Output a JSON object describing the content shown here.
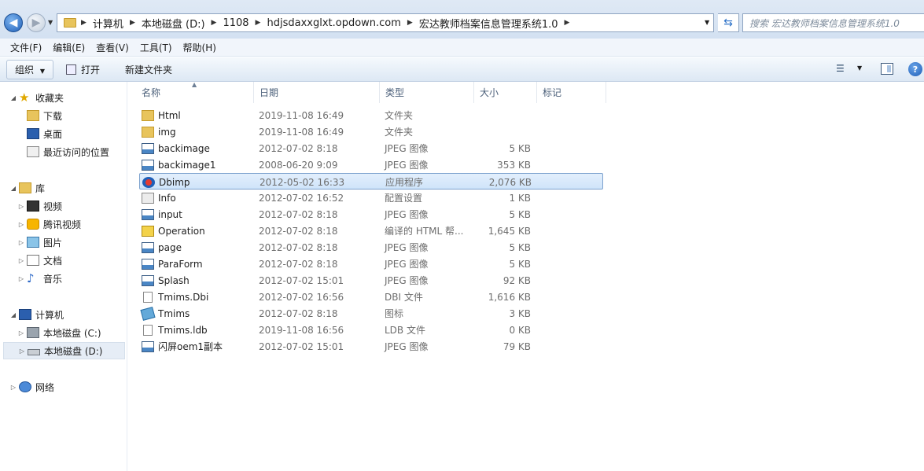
{
  "address": {
    "crumbs": [
      "计算机",
      "本地磁盘 (D:)",
      "1108",
      "hdjsdaxxglxt.opdown.com",
      "宏达教师档案信息管理系统1.0"
    ],
    "search_placeholder": "搜索 宏达教师档案信息管理系统1.0"
  },
  "menu": [
    "文件(F)",
    "编辑(E)",
    "查看(V)",
    "工具(T)",
    "帮助(H)"
  ],
  "toolbar": {
    "organize": "组织",
    "open": "打开",
    "new_folder": "新建文件夹"
  },
  "nav": {
    "favorites": "收藏夹",
    "downloads": "下载",
    "desktop": "桌面",
    "recent": "最近访问的位置",
    "libraries": "库",
    "videos": "视频",
    "tencent_video": "腾讯视频",
    "pictures": "图片",
    "documents": "文档",
    "music": "音乐",
    "computer": "计算机",
    "drive_c": "本地磁盘 (C:)",
    "drive_d": "本地磁盘 (D:)",
    "network": "网络"
  },
  "columns": [
    "名称",
    "日期",
    "类型",
    "大小",
    "标记"
  ],
  "files": [
    {
      "name": "Html",
      "date": "2019-11-08 16:49",
      "type": "文件夹",
      "size": "",
      "icon": "folder-icon"
    },
    {
      "name": "img",
      "date": "2019-11-08 16:49",
      "type": "文件夹",
      "size": "",
      "icon": "folder-icon"
    },
    {
      "name": "backimage",
      "date": "2012-07-02 8:18",
      "type": "JPEG 图像",
      "size": "5 KB",
      "icon": "jpeg-icon"
    },
    {
      "name": "backimage1",
      "date": "2008-06-20 9:09",
      "type": "JPEG 图像",
      "size": "353 KB",
      "icon": "jpeg-icon"
    },
    {
      "name": "Dbimp",
      "date": "2012-05-02 16:33",
      "type": "应用程序",
      "size": "2,076 KB",
      "icon": "app-icon"
    },
    {
      "name": "Info",
      "date": "2012-07-02 16:52",
      "type": "配置设置",
      "size": "1 KB",
      "icon": "config-icon"
    },
    {
      "name": "input",
      "date": "2012-07-02 8:18",
      "type": "JPEG 图像",
      "size": "5 KB",
      "icon": "jpeg-icon"
    },
    {
      "name": "Operation",
      "date": "2012-07-02 8:18",
      "type": "编译的 HTML 帮...",
      "size": "1,645 KB",
      "icon": "help-file-icon"
    },
    {
      "name": "page",
      "date": "2012-07-02 8:18",
      "type": "JPEG 图像",
      "size": "5 KB",
      "icon": "jpeg-icon"
    },
    {
      "name": "ParaForm",
      "date": "2012-07-02 8:18",
      "type": "JPEG 图像",
      "size": "5 KB",
      "icon": "jpeg-icon"
    },
    {
      "name": "Splash",
      "date": "2012-07-02 15:01",
      "type": "JPEG 图像",
      "size": "92 KB",
      "icon": "jpeg-icon"
    },
    {
      "name": "Tmims.Dbi",
      "date": "2012-07-02 16:56",
      "type": "DBI 文件",
      "size": "1,616 KB",
      "icon": "file-icon"
    },
    {
      "name": "Tmims",
      "date": "2012-07-02 8:18",
      "type": "图标",
      "size": "3 KB",
      "icon": "ico-file-icon"
    },
    {
      "name": "Tmims.ldb",
      "date": "2019-11-08 16:56",
      "type": "LDB 文件",
      "size": "0 KB",
      "icon": "file-icon"
    },
    {
      "name": "闪屏oem1副本",
      "date": "2012-07-02 15:01",
      "type": "JPEG 图像",
      "size": "79 KB",
      "icon": "jpeg-icon"
    }
  ]
}
